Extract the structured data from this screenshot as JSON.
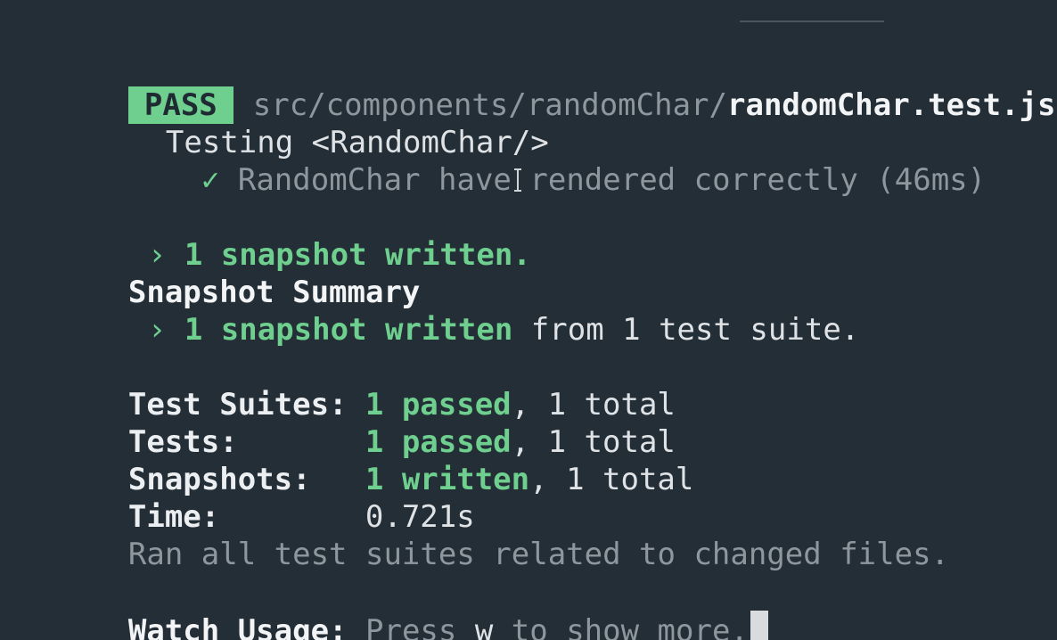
{
  "window": {
    "app": "terminal"
  },
  "result": {
    "badge": "PASS",
    "path_dir": "src/components/randomChar/",
    "path_file": "randomChar.test.js"
  },
  "describe": {
    "label": "Testing <RandomChar/>"
  },
  "test": {
    "check": "✓",
    "name": "RandomChar have rendered correctly (46ms)"
  },
  "snapshot_written": {
    "arrow": "›",
    "text": "1 snapshot written."
  },
  "snapshot_summary": {
    "title": "Snapshot Summary",
    "arrow": "›",
    "highlight": "1 snapshot written",
    "rest": " from 1 test suite."
  },
  "stats": {
    "suites": {
      "label": "Test Suites:",
      "passed": "1 passed",
      "rest": ", 1 total"
    },
    "tests": {
      "label": "Tests:",
      "passed": "1 passed",
      "rest": ", 1 total"
    },
    "snapshots": {
      "label": "Snapshots:",
      "written": "1 written",
      "rest": ", 1 total"
    },
    "time": {
      "label": "Time:",
      "value": "0.721s"
    }
  },
  "ran_note": "Ran all test suites related to changed files.",
  "watch": {
    "label": "Watch Usage:",
    "press": " Press ",
    "key": "w",
    "rest": " to show more."
  },
  "colors": {
    "background": "#242e37",
    "pass_badge": "#6fcf8f",
    "green": "#6fcf8f",
    "dim": "#8e979e"
  }
}
